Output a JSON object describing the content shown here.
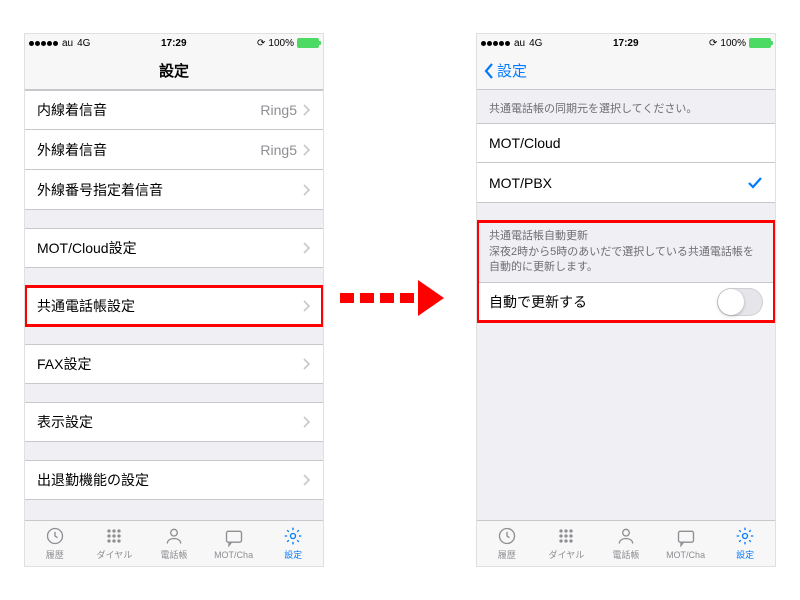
{
  "status": {
    "carrier": "au",
    "network": "4G",
    "time": "17:29",
    "battery_pct": "100%"
  },
  "left": {
    "title": "設定",
    "rows": {
      "ring_internal": {
        "label": "内線着信音",
        "value": "Ring5"
      },
      "ring_external": {
        "label": "外線着信音",
        "value": "Ring5"
      },
      "ring_external_specific": {
        "label": "外線番号指定着信音"
      },
      "mot_cloud": {
        "label": "MOT/Cloud設定"
      },
      "shared_phonebook": {
        "label": "共通電話帳設定"
      },
      "fax": {
        "label": "FAX設定"
      },
      "display": {
        "label": "表示設定"
      },
      "attendance": {
        "label": "出退勤機能の設定"
      }
    }
  },
  "right": {
    "back_label": "設定",
    "section1_header": "共通電話帳の同期元を選択してください。",
    "rows": {
      "mot_cloud": {
        "label": "MOT/Cloud"
      },
      "mot_pbx": {
        "label": "MOT/PBX"
      }
    },
    "section2_header_title": "共通電話帳自動更新",
    "section2_header_desc": "深夜2時から5時のあいだで選択している共通電話帳を自動的に更新します。",
    "auto_update": {
      "label": "自動で更新する"
    }
  },
  "tabs": {
    "history": "履歴",
    "dial": "ダイヤル",
    "contacts": "電話帳",
    "motcha": "MOT/Cha",
    "settings": "設定"
  }
}
